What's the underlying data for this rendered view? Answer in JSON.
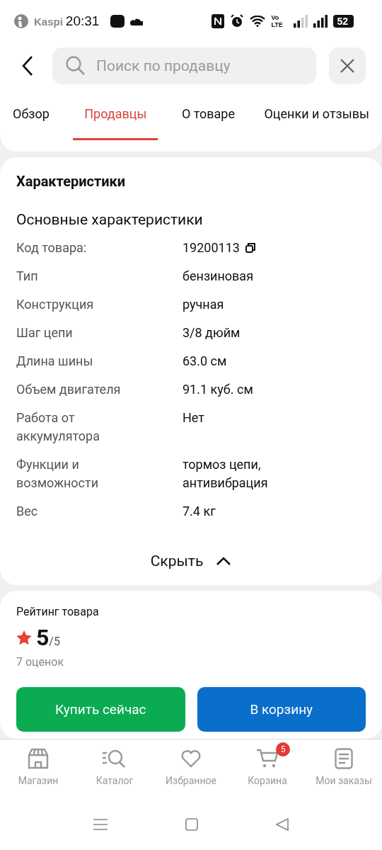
{
  "status_bar": {
    "app_label": "Kaspi",
    "time": "20:31",
    "lte": "Vo LTE",
    "battery": "52"
  },
  "search": {
    "placeholder": "Поиск по продавцу"
  },
  "tabs": [
    {
      "label": "Обзор",
      "selected": false
    },
    {
      "label": "Продавцы",
      "selected": true
    },
    {
      "label": "О товаре",
      "selected": false
    },
    {
      "label": "Оценки и отзывы",
      "selected": false
    }
  ],
  "specs": {
    "title": "Характеристики",
    "section": "Основные характеристики",
    "rows": [
      {
        "label": "Код товара:",
        "value": "19200113",
        "copyable": true
      },
      {
        "label": "Тип",
        "value": "бензиновая",
        "copyable": false
      },
      {
        "label": "Конструкция",
        "value": "ручная",
        "copyable": false
      },
      {
        "label": "Шаг цепи",
        "value": "3/8 дюйм",
        "copyable": false
      },
      {
        "label": "Длина шины",
        "value": "63.0 см",
        "copyable": false
      },
      {
        "label": "Объем двигателя",
        "value": "91.1 куб. см",
        "copyable": false
      },
      {
        "label": "Работа от аккумулятора",
        "value": "Нет",
        "copyable": false
      },
      {
        "label": "Функции и возможности",
        "value": "тормоз цепи, антивибрация",
        "copyable": false
      },
      {
        "label": "Вес",
        "value": "7.4 кг",
        "copyable": false
      }
    ],
    "collapse": "Скрыть"
  },
  "rating": {
    "title": "Рейтинг товара",
    "score": "5",
    "max": "/5",
    "count": "7 оценок"
  },
  "buttons": [
    {
      "label": "Купить сейчас",
      "kind": "buy"
    },
    {
      "label": "В корзину",
      "kind": "cart"
    }
  ],
  "bottom_nav": [
    {
      "label": "Магазин",
      "kind": "store"
    },
    {
      "label": "Каталог",
      "kind": "catalog"
    },
    {
      "label": "Избранное",
      "kind": "heart"
    },
    {
      "label": "Корзина",
      "kind": "cart",
      "badge": "5"
    },
    {
      "label": "Мои заказы",
      "kind": "orders"
    }
  ]
}
